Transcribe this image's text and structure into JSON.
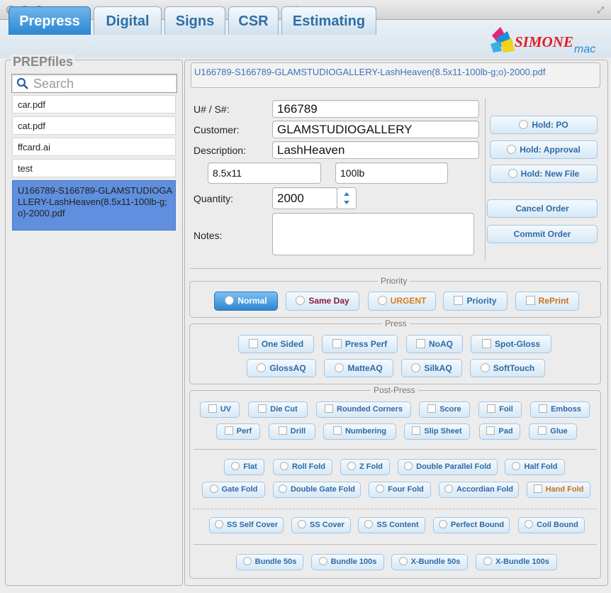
{
  "window": {
    "title": "simone"
  },
  "tabs": [
    {
      "label": "Prepress",
      "active": true
    },
    {
      "label": "Digital"
    },
    {
      "label": "Signs"
    },
    {
      "label": "CSR"
    },
    {
      "label": "Estimating"
    }
  ],
  "logo": {
    "text1": "SIMONE",
    "text2": "mac"
  },
  "left": {
    "group_title": "PREPfiles",
    "search_placeholder": "Search",
    "files": [
      "car.pdf",
      "cat.pdf",
      "ffcard.ai",
      "test",
      "U166789-S166789-GLAMSTUDIOGALLERY-LashHeaven(8.5x11-100lb-g;o)-2000.pdf"
    ],
    "selected_index": 4
  },
  "order": {
    "file_path": "U166789-S166789-GLAMSTUDIOGALLERY-LashHeaven(8.5x11-100lb-g;o)-2000.pdf",
    "labels": {
      "us": "U# / S#:",
      "customer": "Customer:",
      "description": "Description:",
      "quantity": "Quantity:",
      "notes": "Notes:"
    },
    "us_value": "166789",
    "customer_value": "GLAMSTUDIOGALLERY",
    "description_value": "LashHeaven",
    "size_value": "8.5x11",
    "stock_value": "100lb",
    "quantity_value": "2000",
    "notes_value": ""
  },
  "actions": {
    "hold_po": "Hold: PO",
    "hold_approval": "Hold: Approval",
    "hold_new_file": "Hold: New File",
    "cancel": "Cancel Order",
    "commit": "Commit Order"
  },
  "priority": {
    "title": "Priority",
    "normal": "Normal",
    "same_day": "Same Day",
    "urgent": "URGENT",
    "priority": "Priority",
    "reprint": "RePrint",
    "colors": {
      "same_day": "#8b1a3b",
      "urgent": "#d6801a",
      "reprint": "#c8731c",
      "active": "#2f86d1"
    }
  },
  "press": {
    "title": "Press",
    "row1": [
      "One Sided",
      "Press Perf",
      "NoAQ",
      "Spot-Gloss"
    ],
    "row2": [
      "GlossAQ",
      "MatteAQ",
      "SilkAQ",
      "SoftTouch"
    ]
  },
  "postpress": {
    "title": "Post-Press",
    "row1": [
      "UV",
      "Die Cut",
      "Rounded Corners",
      "Score",
      "Foil",
      "Emboss"
    ],
    "row2": [
      "Perf",
      "Drill",
      "Numbering",
      "Slip Sheet",
      "Pad",
      "Glue"
    ],
    "row3": [
      "Flat",
      "Roll Fold",
      "Z Fold",
      "Double Parallel Fold",
      "Half Fold"
    ],
    "row4": [
      "Gate Fold",
      "Double Gate Fold",
      "Four Fold",
      "Accordian Fold",
      "Hand Fold"
    ],
    "row5": [
      "SS Self Cover",
      "SS Cover",
      "SS Content",
      "Perfect Bound",
      "Coil Bound"
    ],
    "row6": [
      "Bundle 50s",
      "Bundle 100s",
      "X-Bundle 50s",
      "X-Bundle 100s"
    ]
  }
}
